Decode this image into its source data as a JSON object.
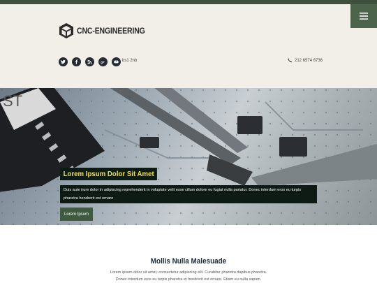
{
  "header": {
    "logo_text": "CNC-ENGINEERING",
    "postcode": "bs1 2nb",
    "phone": "212 6574 6736",
    "menu_icon": "hamburger-icon",
    "socials": [
      "twitter-icon",
      "facebook-icon",
      "rss-icon",
      "google-plus-icon",
      "youtube-icon"
    ]
  },
  "hero": {
    "title": "Lorem Ipsum Dolor Sit Amet",
    "text": "Duis aute irure dolor in adipiscing reprehenderit in voluptate velit esse cillum dolore eu fugiat nulla pariatur. Donec interdum eros eu turpis pharetra hendrerit est ornare",
    "button_label": "Lorem Ipsum"
  },
  "section": {
    "title": "Mollis Nulla Malesuade",
    "line1": "Lorem ipsum dolor sit amet, consectetur adipiscing elit. Curabitur pharetra dapibus pharetra.",
    "line2": "Donec interdum eros eu turpis pharetra et hendrerit est ornare. Etiam eu nulla sapien."
  },
  "colors": {
    "topbar": "#3e4f3b",
    "header_bg": "#f2eee8",
    "menu_bg": "#4d644c",
    "hero_title_text": "#f2e23a",
    "button_bg": "#3f5a3f"
  }
}
